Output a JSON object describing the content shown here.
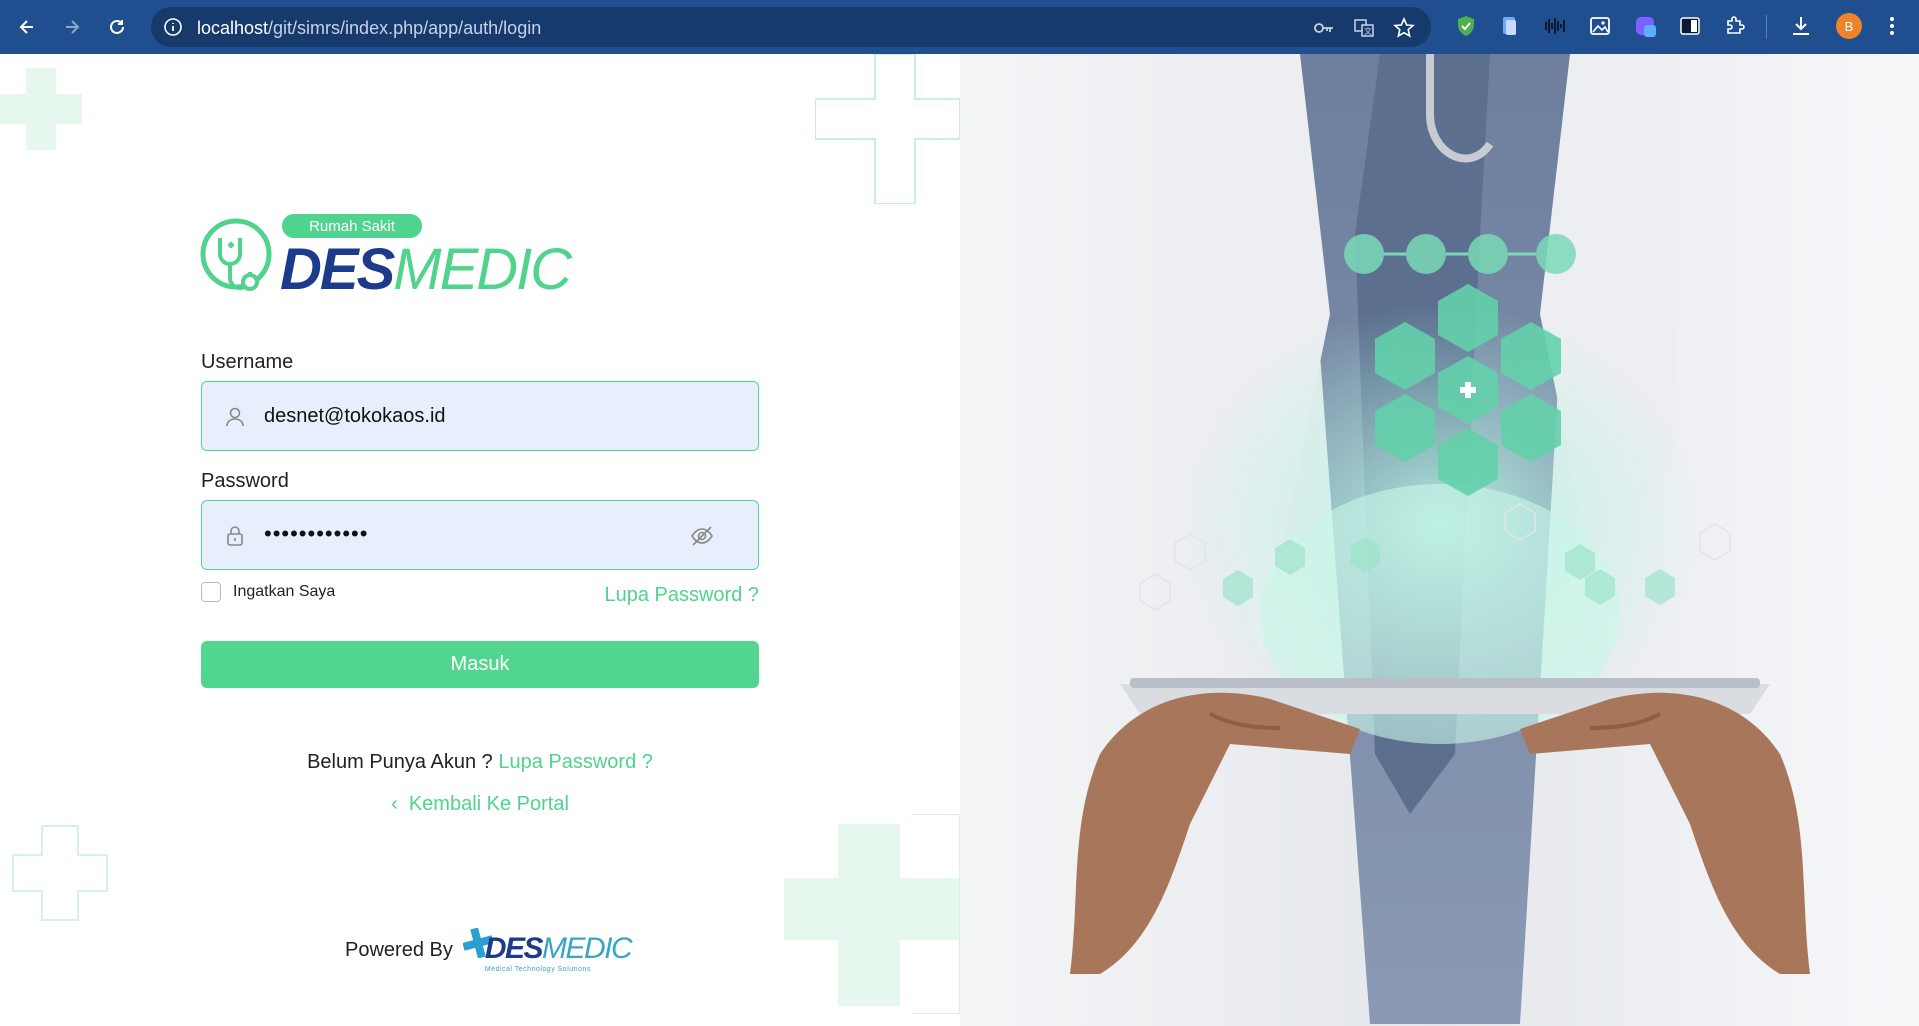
{
  "browser": {
    "url_host": "localhost",
    "url_path": "/git/simrs/index.php/app/auth/login",
    "profile_initial": "B"
  },
  "logo": {
    "pill": "Rumah Sakit",
    "word_a": "DES",
    "word_b": "MEDIC"
  },
  "form": {
    "username_label": "Username",
    "username_value": "desnet@tokokaos.id",
    "password_label": "Password",
    "password_value": "••••••••••••",
    "remember_label": "Ingatkan Saya",
    "forgot_label": "Lupa Password ?",
    "submit_label": "Masuk"
  },
  "footer": {
    "register_text": "Belum Punya Akun ?",
    "register_link": "Lupa Password ?",
    "back_link": "Kembali Ke Portal",
    "powered_label": "Powered By",
    "powered_word_a": "DES",
    "powered_word_b": "MEDIC",
    "powered_tagline": "Medical Technology Solutions"
  },
  "colors": {
    "brand_green": "#4fd38d",
    "brand_navy": "#1c3b8b",
    "chrome": "#1f4f8f"
  }
}
